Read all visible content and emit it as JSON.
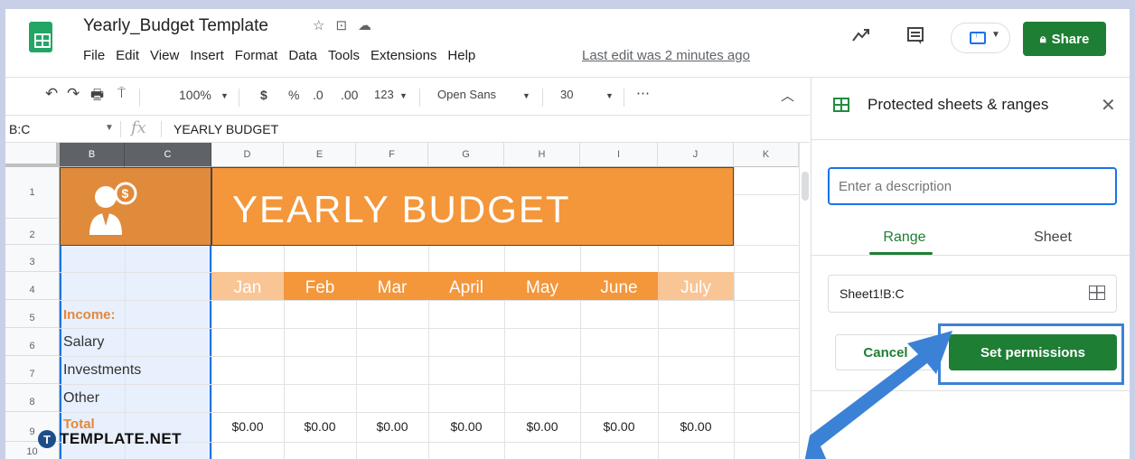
{
  "doc": {
    "title": "Yearly_Budget Template",
    "last_edit": "Last edit was 2 minutes ago"
  },
  "menu": [
    "File",
    "Edit",
    "View",
    "Insert",
    "Format",
    "Data",
    "Tools",
    "Extensions",
    "Help"
  ],
  "header": {
    "share_label": "Share"
  },
  "toolbar": {
    "zoom": "100%",
    "currency": "$",
    "percent": "%",
    "dec_decrease": ".0",
    "dec_increase": ".00",
    "format_more": "123",
    "font": "Open Sans",
    "font_size": "30",
    "more": "⋯"
  },
  "formula_bar": {
    "name_box": "B:C",
    "fx": "fx",
    "content": "YEARLY BUDGET"
  },
  "grid": {
    "columns": [
      "B",
      "C",
      "D",
      "E",
      "F",
      "G",
      "H",
      "I",
      "J",
      "K"
    ],
    "rows": [
      "1",
      "2",
      "3",
      "4",
      "5",
      "6",
      "7",
      "8",
      "9",
      "10"
    ],
    "banner_title": "YEARLY  BUDGET",
    "months": [
      "Jan",
      "Feb",
      "Mar",
      "April",
      "May",
      "June",
      "July"
    ],
    "row_labels": {
      "income": "Income:",
      "salary": "Salary",
      "investments": "Investments",
      "other": "Other",
      "total": "Total"
    },
    "totals": [
      "$0.00",
      "$0.00",
      "$0.00",
      "$0.00",
      "$0.00",
      "$0.00",
      "$0.00"
    ]
  },
  "watermark": {
    "logo_letter": "T",
    "text": "TEMPLATE.NET"
  },
  "panel": {
    "title": "Protected sheets & ranges",
    "description_placeholder": "Enter a description",
    "tabs": [
      "Range",
      "Sheet"
    ],
    "range_value": "Sheet1!B:C",
    "cancel_label": "Cancel",
    "set_permissions_label": "Set permissions"
  },
  "colors": {
    "accent_green": "#1e7e34",
    "banner_orange": "#f4963a",
    "highlight_blue": "#3b82d6"
  }
}
